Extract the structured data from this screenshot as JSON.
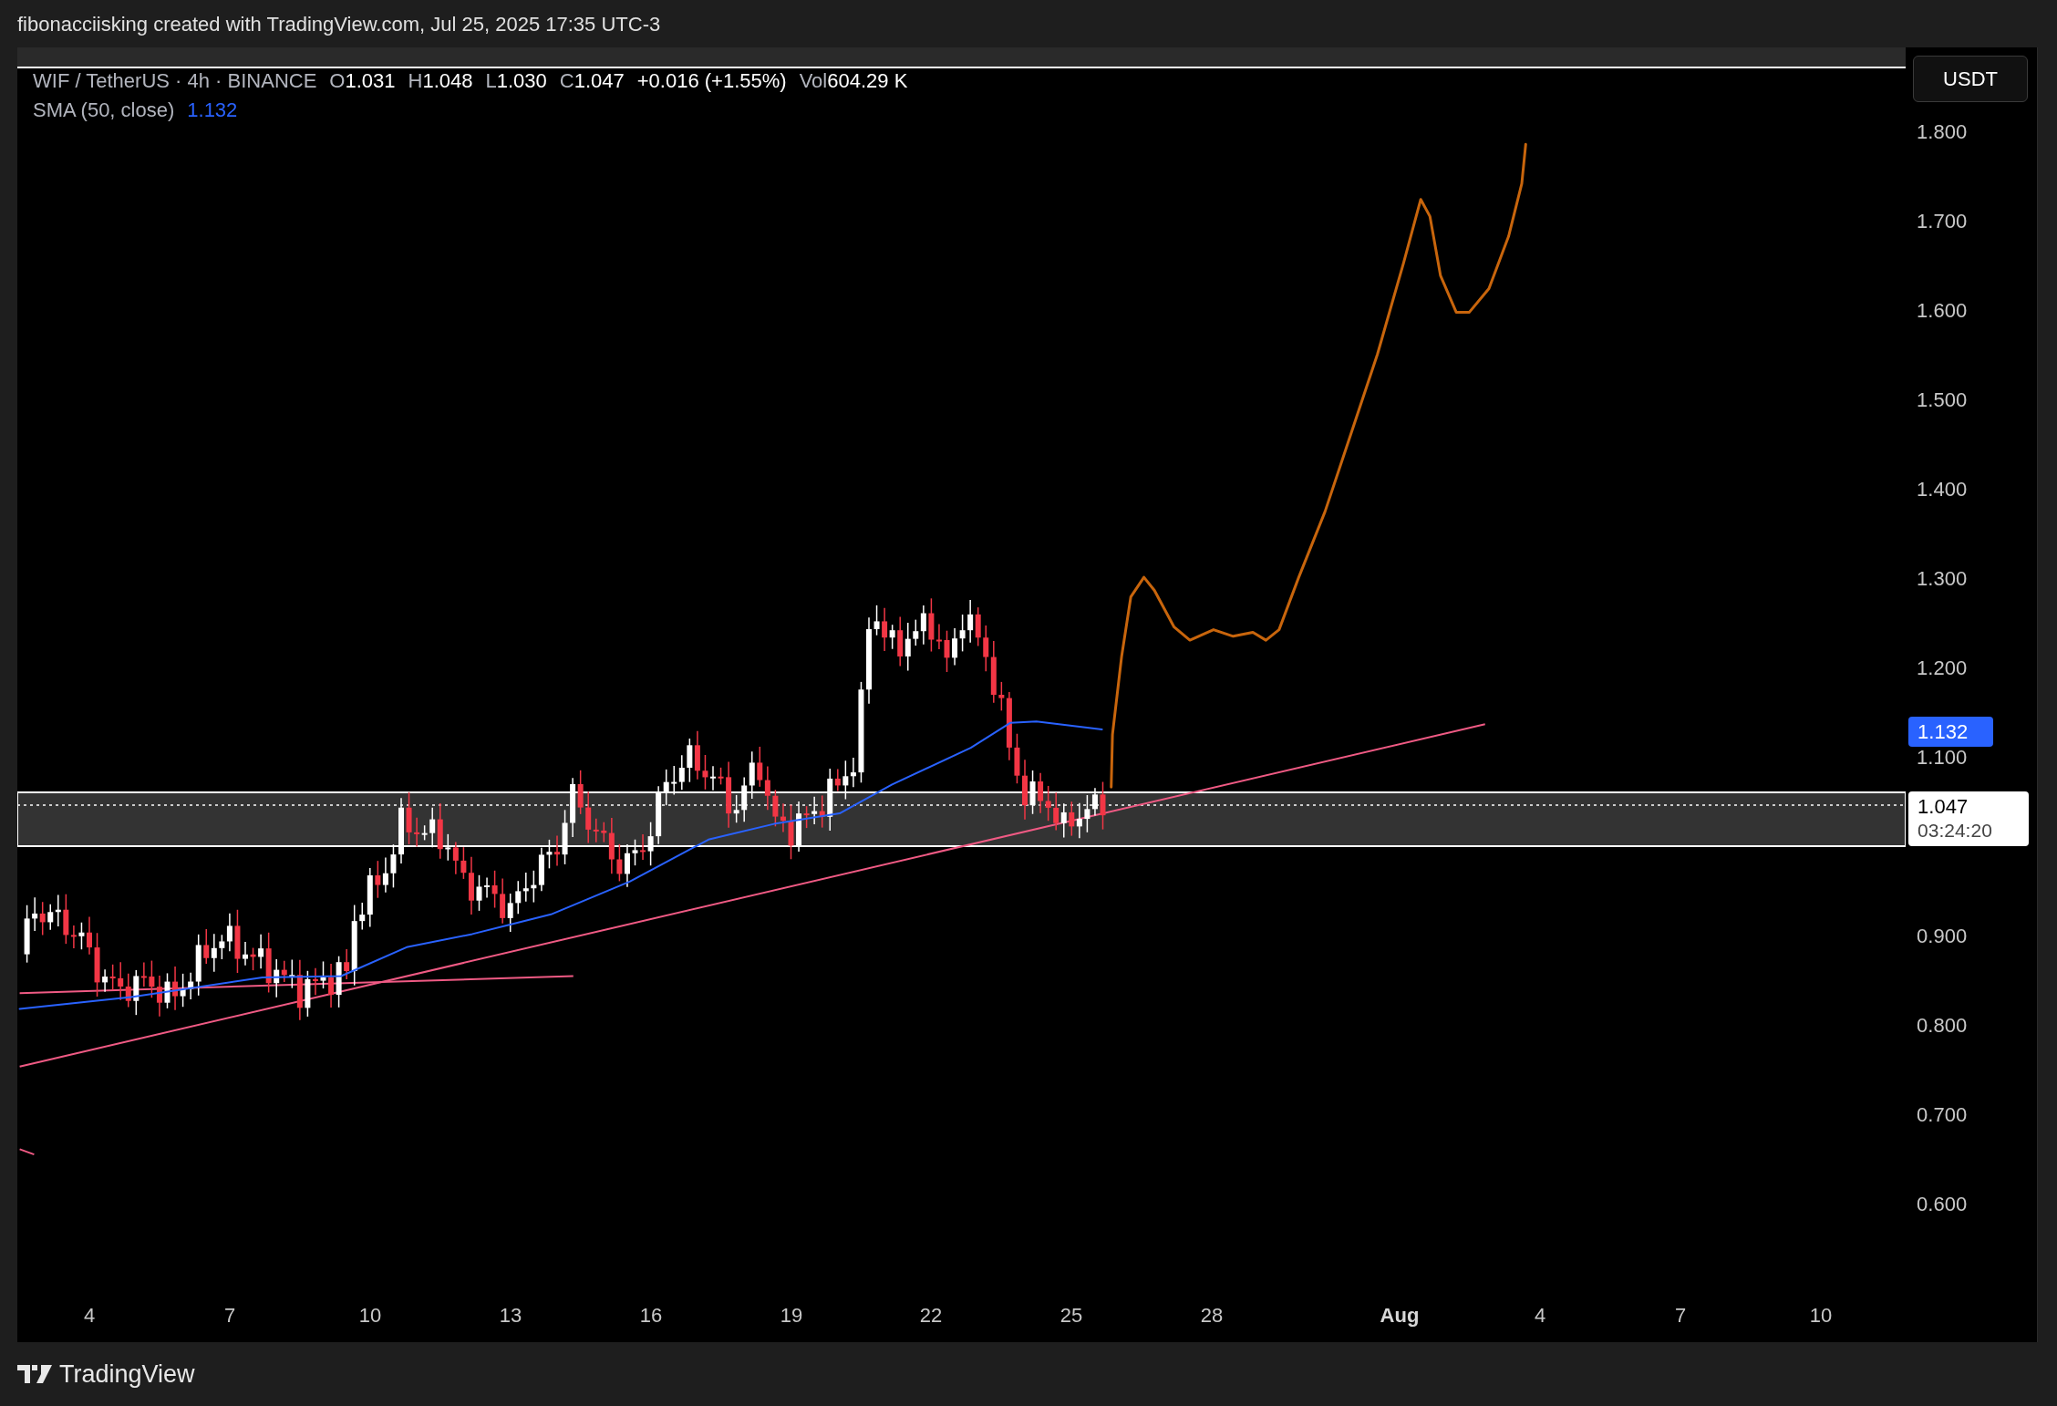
{
  "header": {
    "caption": "fibonacciisking created with TradingView.com, Jul 25, 2025 17:35 UTC-3"
  },
  "legend": {
    "symbol": "WIF / TetherUS · 4h · BINANCE",
    "ohlc": [
      {
        "label": "O",
        "value": "1.031"
      },
      {
        "label": "H",
        "value": "1.048"
      },
      {
        "label": "L",
        "value": "1.030"
      },
      {
        "label": "C",
        "value": "1.047"
      }
    ],
    "change": "+0.016 (+1.55%)",
    "volume_label": "Vol",
    "volume": "604.29 K"
  },
  "indicator": {
    "name": "SMA (50, close)",
    "value": "1.132"
  },
  "price_axis": {
    "currency": "USDT",
    "ticks": [
      "1.800",
      "1.700",
      "1.600",
      "1.500",
      "1.400",
      "1.300",
      "1.200",
      "1.100",
      "0.900",
      "0.800",
      "0.700",
      "0.600"
    ],
    "sma_tag": "1.132",
    "last_price_tag": {
      "price": "1.047",
      "countdown": "03:24:20"
    }
  },
  "time_axis": {
    "ticks": [
      {
        "label": "4",
        "month_start": false
      },
      {
        "label": "7",
        "month_start": false
      },
      {
        "label": "10",
        "month_start": false
      },
      {
        "label": "13",
        "month_start": false
      },
      {
        "label": "16",
        "month_start": false
      },
      {
        "label": "19",
        "month_start": false
      },
      {
        "label": "22",
        "month_start": false
      },
      {
        "label": "25",
        "month_start": false
      },
      {
        "label": "28",
        "month_start": false
      },
      {
        "label": "Aug",
        "month_start": true
      },
      {
        "label": "4",
        "month_start": false
      },
      {
        "label": "7",
        "month_start": false
      },
      {
        "label": "10",
        "month_start": false
      }
    ]
  },
  "footer": {
    "brand": "TradingView"
  }
}
